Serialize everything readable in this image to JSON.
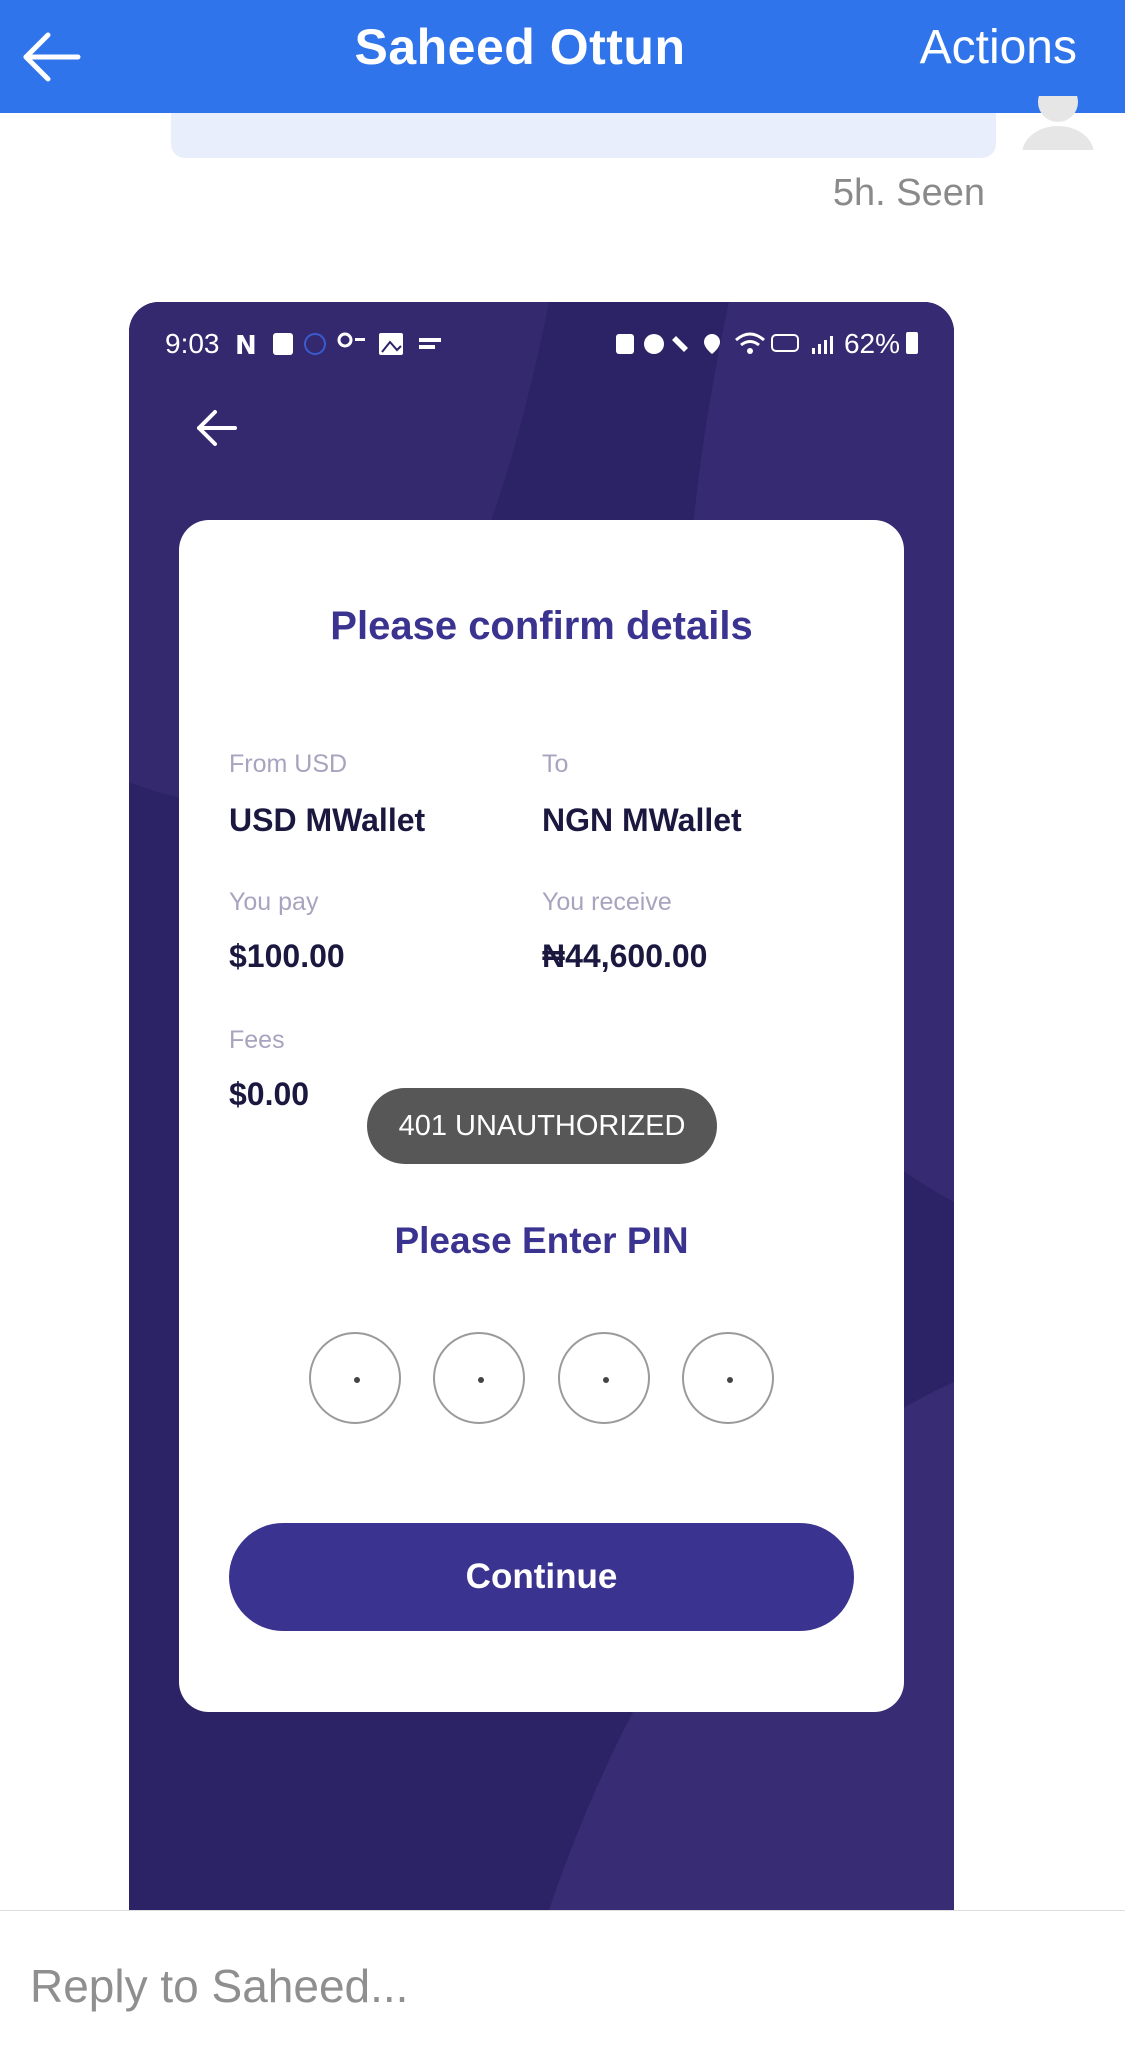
{
  "header": {
    "title": "Saheed Ottun",
    "actions_label": "Actions",
    "background_color": "#2f74ea"
  },
  "chat": {
    "seen_status": "5h. Seen"
  },
  "shared_screenshot": {
    "status_bar": {
      "time": "9:03",
      "battery": "62%"
    },
    "confirm": {
      "title": "Please confirm details",
      "from_label": "From USD",
      "from_value": "USD MWallet",
      "to_label": "To",
      "to_value": "NGN MWallet",
      "pay_label": "You pay",
      "pay_value": "$100.00",
      "receive_label": "You receive",
      "receive_value": "₦44,600.00",
      "fees_label": "Fees",
      "fees_value": "$0.00"
    },
    "toast": "401 UNAUTHORIZED",
    "pin_title": "Please Enter PIN",
    "pin_digits": 4,
    "continue_label": "Continue",
    "accent_color": "#3b3390",
    "background_color": "#2e2466"
  },
  "composer": {
    "placeholder": "Reply to Saheed..."
  }
}
